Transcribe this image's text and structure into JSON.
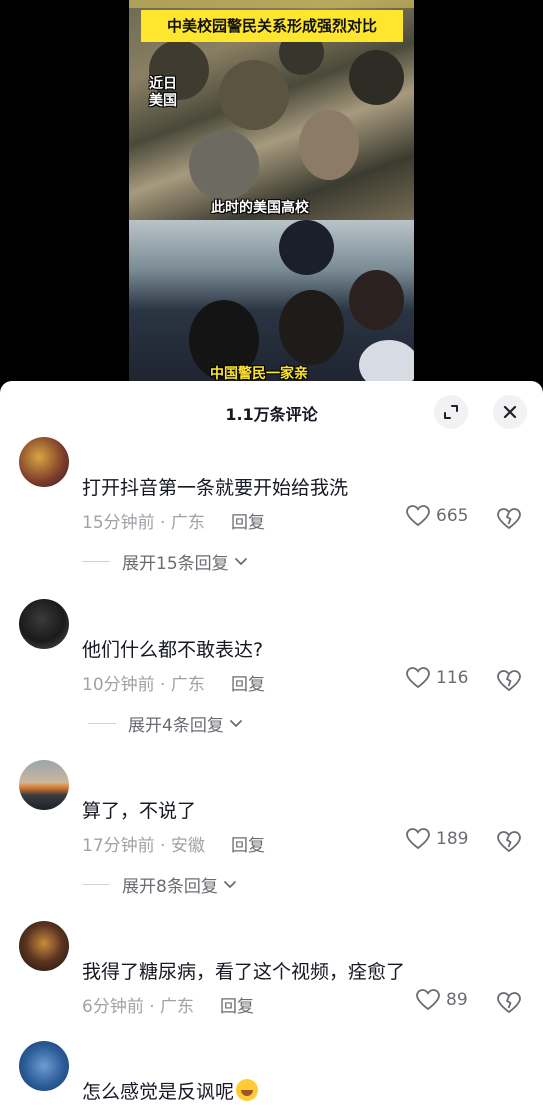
{
  "video": {
    "headline": "中美校园警民关系形成强烈对比",
    "label_top_left": "近日\n美国",
    "label_us": "此时的美国高校",
    "label_cn": "中国警民一家亲"
  },
  "sheet": {
    "title": "1.1万条评论",
    "expand_icon": "expand-icon",
    "close_icon": "close-icon"
  },
  "comments": [
    {
      "text": "打开抖音第一条就要开始给我洗",
      "time_loc": "15分钟前 · 广东",
      "reply": "回复",
      "likes": "665",
      "expand": "展开15条回复"
    },
    {
      "text": "他们什么都不敢表达?",
      "time_loc": "10分钟前 · 广东",
      "reply": "回复",
      "likes": "116",
      "expand": "展开4条回复"
    },
    {
      "text": "算了，不说了",
      "time_loc": "17分钟前 · 安徽",
      "reply": "回复",
      "likes": "189",
      "expand": "展开8条回复"
    },
    {
      "text": "我得了糖尿病，看了这个视频，痊愈了",
      "time_loc": "6分钟前 · 广东",
      "reply": "回复",
      "likes": "89"
    },
    {
      "text": "怎么感觉是反讽呢"
    }
  ],
  "colors": {
    "headline_bg": "#ffe62e",
    "text_primary": "#161823",
    "text_meta": "#a1a2a7"
  }
}
